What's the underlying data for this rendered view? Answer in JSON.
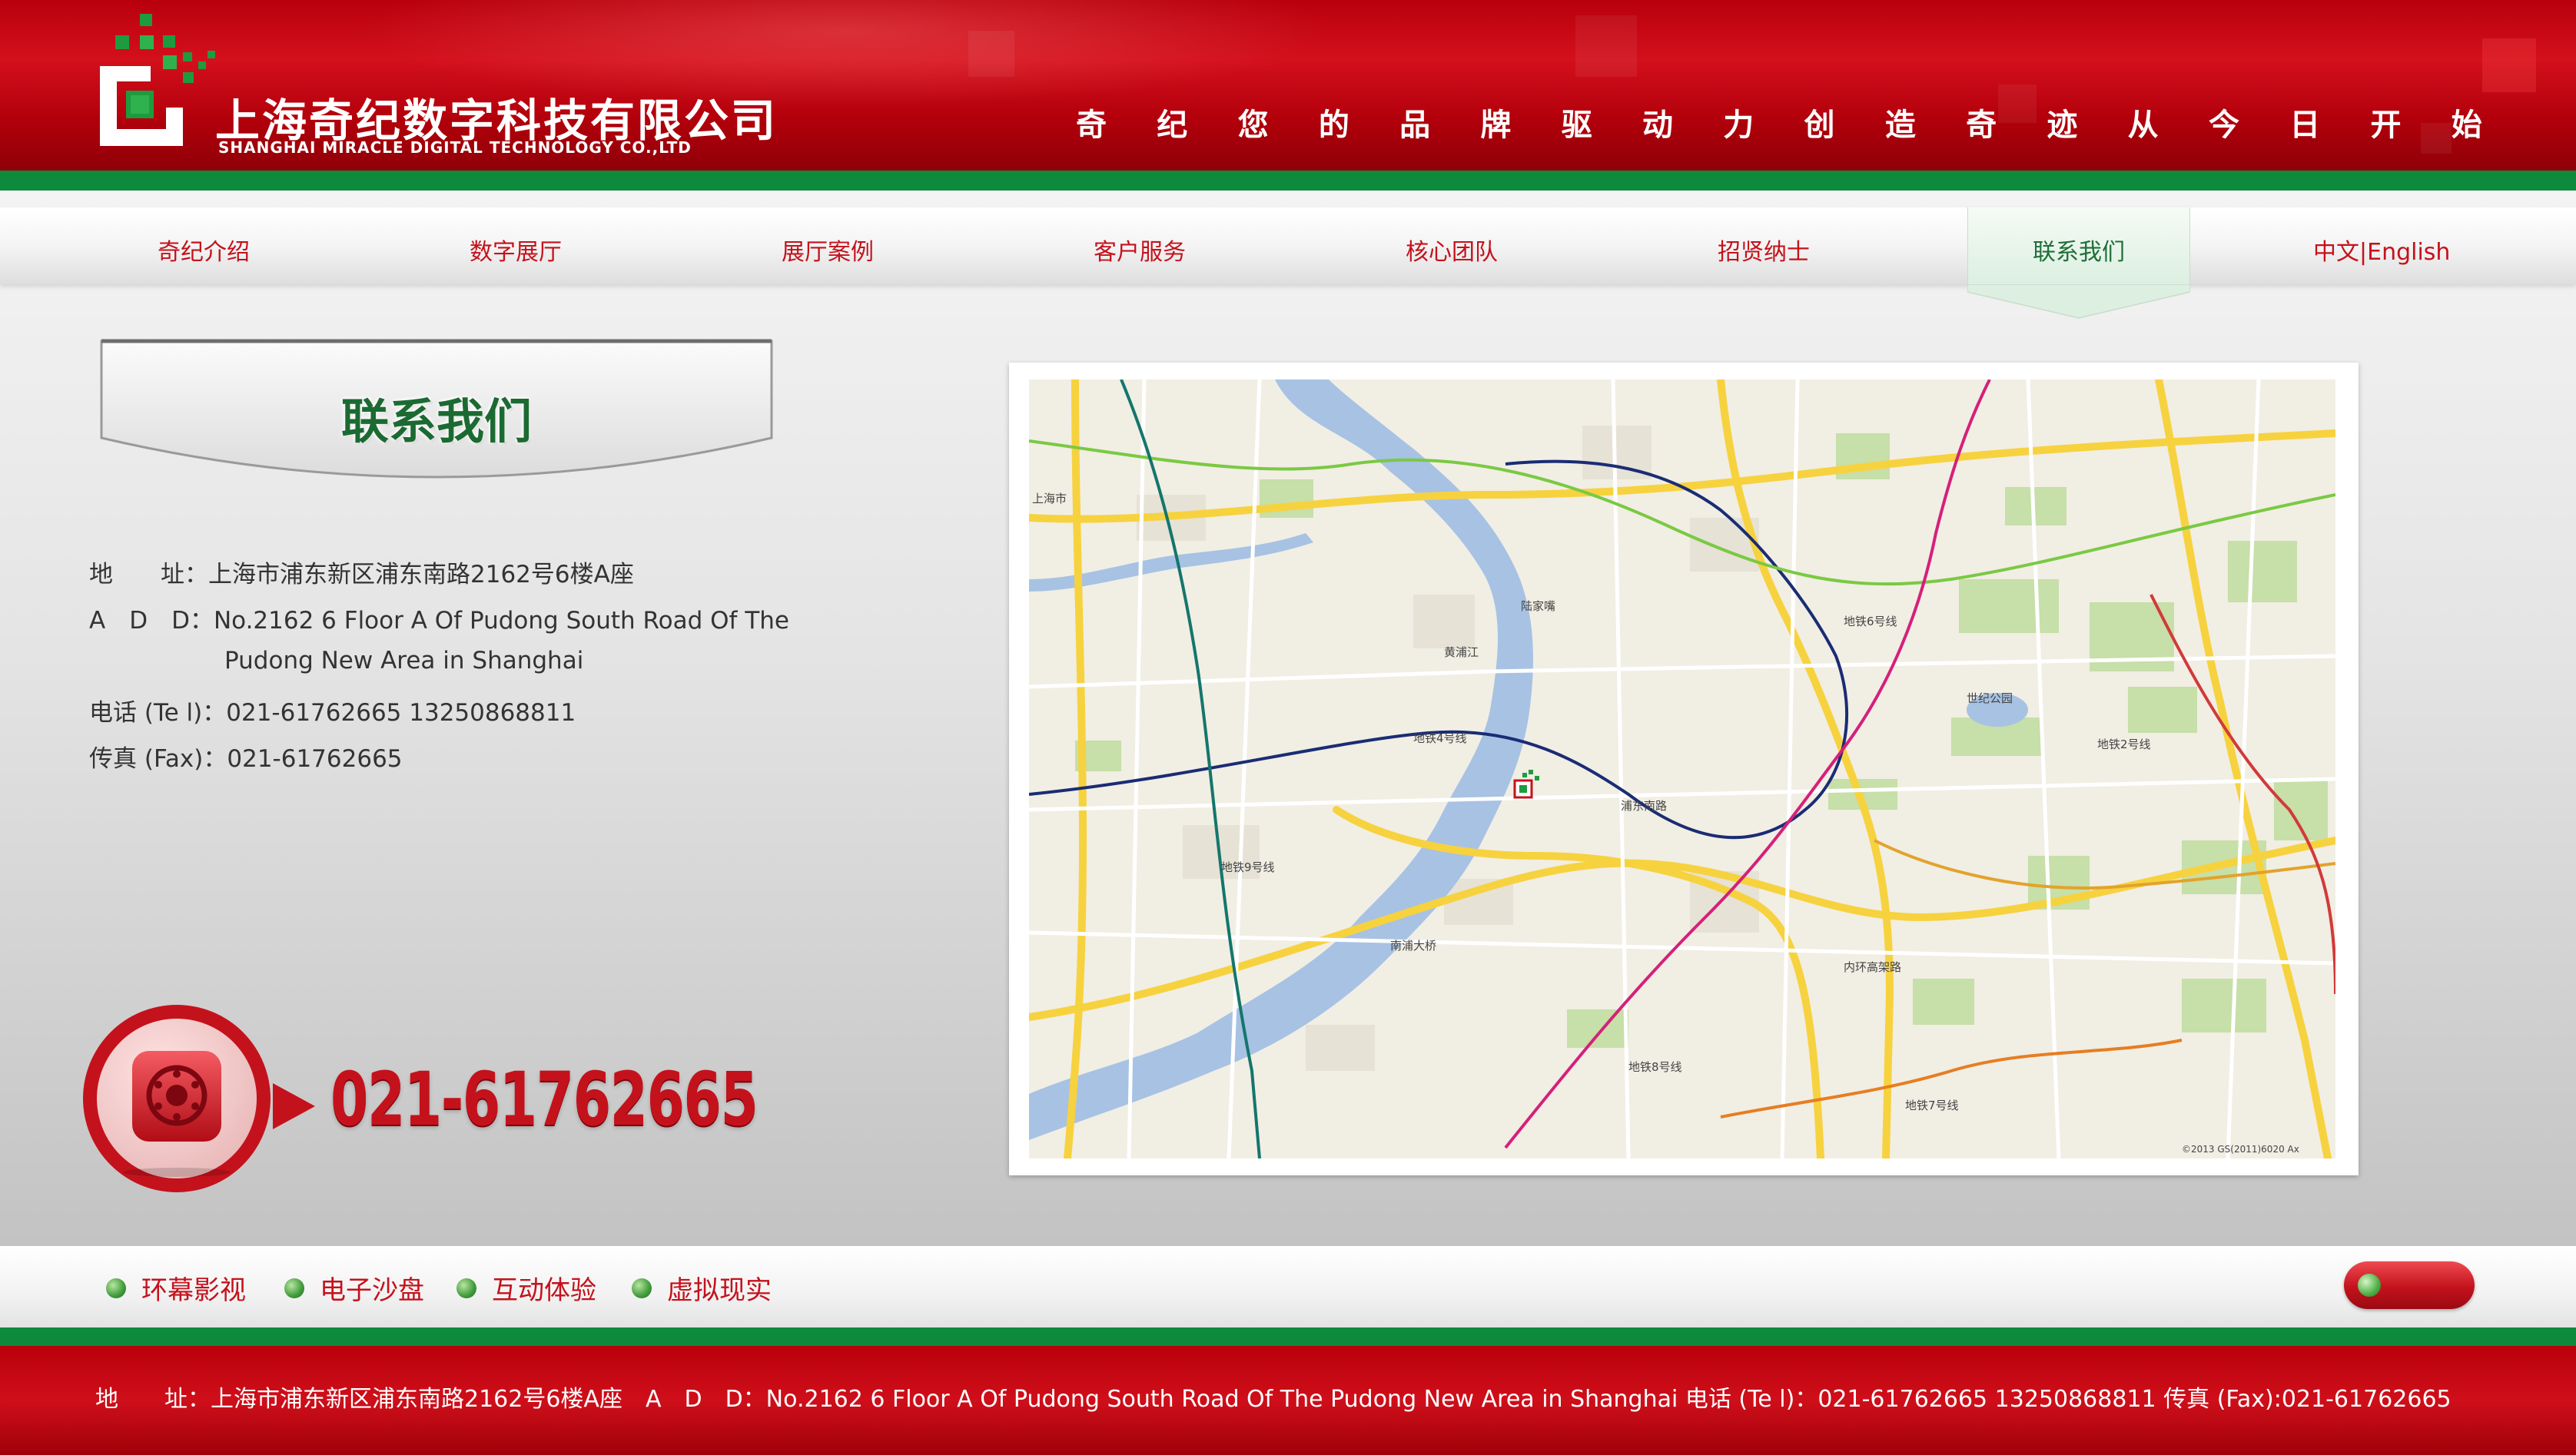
{
  "header": {
    "logo_cn": "上海奇纪数字科技有限公司",
    "logo_en": "SHANGHAI MIRACLE DIGITAL TECHNOLOGY CO.,LTD",
    "slogan": [
      "奇",
      "纪",
      "您",
      "的",
      "品",
      "牌",
      "驱",
      "动",
      "力",
      "创",
      "造",
      "奇",
      "迹",
      "从",
      "今",
      "日",
      "开",
      "始"
    ]
  },
  "nav": {
    "items": [
      {
        "label": "奇纪介绍"
      },
      {
        "label": "数字展厅"
      },
      {
        "label": "展厅案例"
      },
      {
        "label": "客户服务"
      },
      {
        "label": "核心团队"
      },
      {
        "label": "招贤纳士"
      },
      {
        "label": "联系我们",
        "active": true
      }
    ],
    "lang_cn": "中文",
    "lang_sep": "|",
    "lang_en": "English"
  },
  "contact": {
    "title": "联系我们",
    "address_label": "地　　址：",
    "address": "上海市浦东新区浦东南路2162号6楼A座",
    "ad_label": "A　D　D：",
    "ad_line1": "No.2162 6 Floor A Of Pudong South Road Of The",
    "ad_line2": "Pudong New Area in Shanghai",
    "tel_label": "电话 (Te l)：",
    "tel": "021-61762665 13250868811",
    "fax_label": "传真 (Fax)：",
    "fax": "021-61762665",
    "phone_big": "021-61762665"
  },
  "map": {
    "labels": {
      "river_bridge_1": "南浦大桥",
      "ring_road": "内环高架路",
      "metro_4": "地铁4号线",
      "metro_6": "地铁6号线",
      "metro_7": "地铁7号线",
      "metro_2": "地铁2号线",
      "metro_8": "地铁8号线",
      "metro_9": "地铁9号线",
      "huangpu": "黄浦江",
      "pudong_south": "浦东南路",
      "century_park": "世纪公园",
      "shanghai_city": "上海市",
      "lujiazui": "陆家嘴",
      "copyright": "©2013 GS(2011)6020 Ax"
    }
  },
  "bottom_links": [
    {
      "label": "环幕影视"
    },
    {
      "label": "电子沙盘"
    },
    {
      "label": "互动体验"
    },
    {
      "label": "虚拟现实"
    }
  ],
  "footer": {
    "text": "地　　址：上海市浦东新区浦东南路2162号6楼A座　A　D　D：No.2162 6 Floor A Of Pudong South Road Of The Pudong New Area in Shanghai  电话 (Te l)：021-61762665 13250868811  传真 (Fax):021-61762665"
  },
  "colors": {
    "brand_red": "#c4121c",
    "brand_green": "#0e8a3c",
    "title_green": "#1b6a32"
  }
}
